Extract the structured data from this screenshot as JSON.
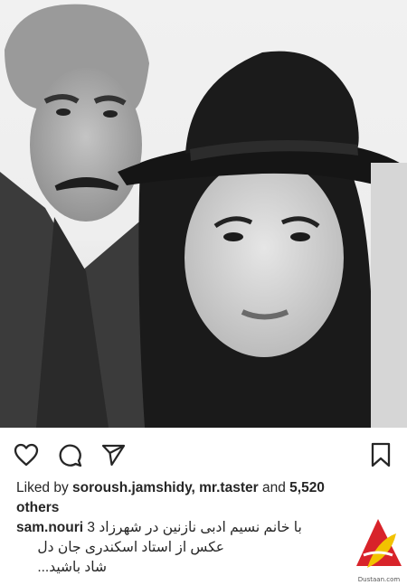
{
  "post": {
    "likes_prefix": "Liked by",
    "liked_users": "soroush.jamshidy, mr.taster",
    "likes_joiner": "and",
    "likes_count": "5,520",
    "likes_suffix": "others",
    "caption_user": "sam.nouri",
    "caption_line1": "با خانم نسیم ادبی نازنین در شهرزاد 3",
    "caption_line2": "عکس از استاد اسکندری جان دل",
    "caption_line3": "شاد باشید...",
    "watermark": "Dustaan.com"
  },
  "icons": {
    "like": "heart-icon",
    "comment": "comment-icon",
    "share": "paper-plane-icon",
    "save": "bookmark-icon"
  },
  "colors": {
    "text": "#262626",
    "watermark_red": "#d8232a",
    "watermark_yellow": "#f2c200"
  }
}
